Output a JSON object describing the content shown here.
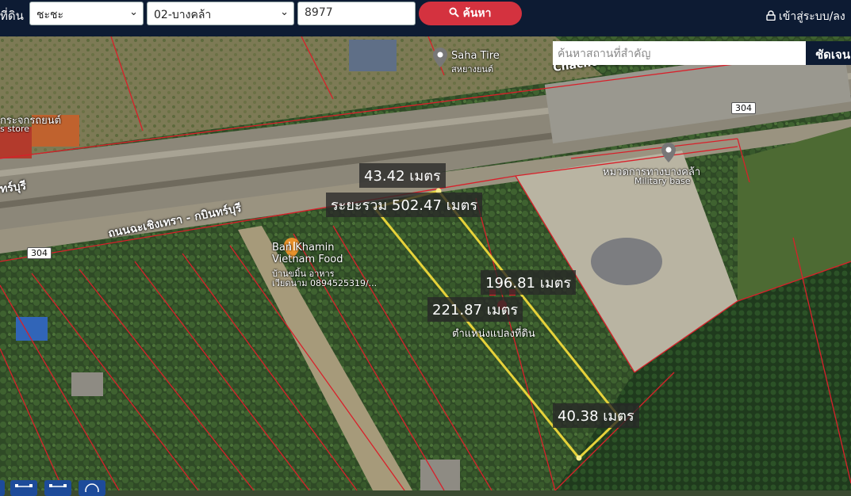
{
  "header": {
    "land_label": "ที่ดิน",
    "province": "ชะชะ",
    "district": "02-บางคล้า",
    "parcel_number": "8977",
    "search_button": "ค้นหา",
    "login_link": "เข้าสู่ระบบ/ลง"
  },
  "map": {
    "place_search_placeholder": "ค้นหาสถานที่สำคัญ",
    "place_search_button": "ชัดเจน",
    "pois": {
      "saha_tire": "Saha Tire",
      "saha_tire_th": "สหยางยนต์",
      "military_th": "หมวดการทางบางคล้า",
      "military_en": "Military base",
      "restaurant_en1": "Ban Khamin",
      "restaurant_en2": "Vietnam Food",
      "restaurant_th": "บ้านขมิ้น อาหาร",
      "restaurant_phone": "เวียดนาม 0894525319/...",
      "store_th": "กระจกรถยนต์",
      "store_en": "s store",
      "chachoeng": "Chachoeng",
      "road_fragment": "ทร์บุรี",
      "road_name": "ถนนฉะเชิงเทรา - กบินทร์บุรี"
    },
    "route_shield": "304",
    "parcel_marker_label": "ตำแหน่งแปลงที่ดิน",
    "measurements": {
      "total": "ระยะรวม 502.47 เมตร",
      "top": "43.42 เมตร",
      "right": "196.81 เมตร",
      "left": "221.87 เมตร",
      "bottom": "40.38 เมตร"
    }
  },
  "colors": {
    "topbar": "#0d1b33",
    "search_button": "#d4323f",
    "parcel_outline": "#e6d23a",
    "cadastral_lines": "#d8202a"
  }
}
